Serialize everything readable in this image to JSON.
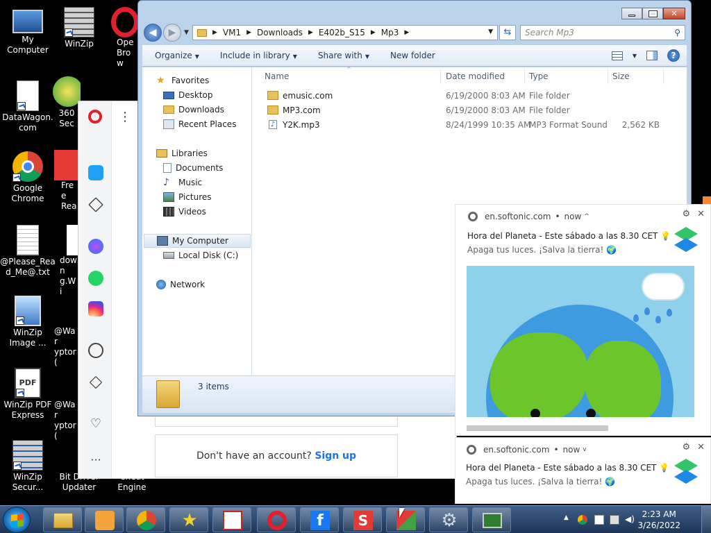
{
  "desktop": {
    "icons": [
      {
        "label": "My Computer"
      },
      {
        "label": "WinZip"
      },
      {
        "label": "Ope Brow"
      },
      {
        "label": "DataWagon.com"
      },
      {
        "label": "360 Sec"
      },
      {
        "label": "Google Chrome"
      },
      {
        "label": "Free Rea"
      },
      {
        "label": "@Please_Read_Me@.txt"
      },
      {
        "label": "down g.Wi"
      },
      {
        "label": "WinZip Image ..."
      },
      {
        "label": "@War yptor("
      },
      {
        "label": "WinZip PDF Express"
      },
      {
        "label": "@War yptor("
      },
      {
        "label": "WinZip Secur..."
      },
      {
        "label": "Bit Driver Updater"
      },
      {
        "label": "Cheat Engine"
      }
    ]
  },
  "opera": {
    "signup_text": "Don't have an account?",
    "signup_link": "Sign up"
  },
  "explorer": {
    "breadcrumbs": [
      "VM1",
      "Downloads",
      "E402b_S15",
      "Mp3"
    ],
    "search_placeholder": "Search Mp3",
    "toolbar": {
      "organize": "Organize",
      "include_in_library": "Include in library",
      "share_with": "Share with",
      "new_folder": "New folder"
    },
    "nav": {
      "favorites": "Favorites",
      "desktop": "Desktop",
      "downloads": "Downloads",
      "recent_places": "Recent Places",
      "libraries": "Libraries",
      "documents": "Documents",
      "music": "Music",
      "pictures": "Pictures",
      "videos": "Videos",
      "my_computer": "My Computer",
      "local_disk": "Local Disk (C:)",
      "network": "Network"
    },
    "columns": {
      "name": "Name",
      "date_modified": "Date modified",
      "type": "Type",
      "size": "Size"
    },
    "files": [
      {
        "name": "emusic.com",
        "date": "6/19/2000 8:03 AM",
        "type": "File folder",
        "size": ""
      },
      {
        "name": "MP3.com",
        "date": "6/19/2000 8:03 AM",
        "type": "File folder",
        "size": ""
      },
      {
        "name": "Y2K.mp3",
        "date": "8/24/1999 10:35 AM",
        "type": "MP3 Format Sound",
        "size": "2,562 KB"
      }
    ],
    "status": "3 items"
  },
  "notifications": [
    {
      "source": "en.softonic.com",
      "time": "now",
      "title": "Hora del Planeta - Este sábado a las 8.30 CET 💡",
      "body": "Apaga tus luces. ¡Salva la tierra! 🌍"
    },
    {
      "source": "en.softonic.com",
      "time": "now",
      "title": "Hora del Planeta - Este sábado a las 8.30 CET 💡",
      "body": "Apaga tus luces. ¡Salva la tierra! 🌍"
    }
  ],
  "taskbar": {
    "time": "2:23 AM",
    "date": "3/26/2022"
  },
  "colors": {
    "accent": "#1a73e8",
    "opera_red": "#e01f2f",
    "taskbar": "#1d3556"
  }
}
